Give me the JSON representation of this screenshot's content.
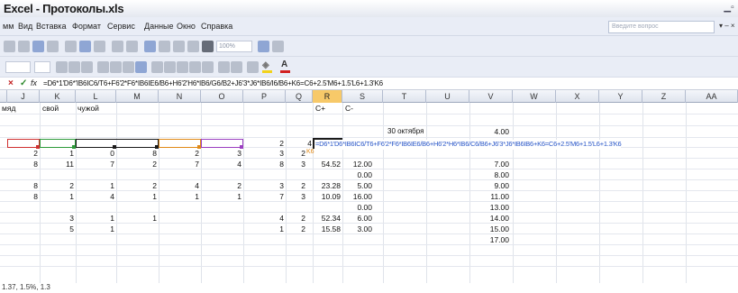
{
  "window": {
    "title": "Excel - Протоколы.xls",
    "controls_icon": "minimize-icon"
  },
  "menu": {
    "items": [
      "мм",
      "Вид",
      "Вставка",
      "Формат",
      "Сервис",
      "Данные",
      "Окно",
      "Справка"
    ],
    "help_placeholder": "Введите вопрос",
    "window_controls": "▾ – ×"
  },
  "toolbar": {
    "zoom": "100%"
  },
  "formula_bar": {
    "cancel_icon": "×",
    "enter_icon": "✓",
    "fx_label": "fx",
    "content": "=D6*1'D6*'IB6IC6/T6+F6'2*F6*IB6IE6/B6+H6'2'H6*IB6/G6/B2+J6'3*J6*IB6/I6/B6+K6=C6+2.5'M6+1.5'L6+1.3'K6"
  },
  "columns": [
    "J",
    "K",
    "L",
    "M",
    "N",
    "O",
    "P",
    "Q",
    "R",
    "S",
    "T",
    "U",
    "V",
    "W",
    "X",
    "Y",
    "Z",
    "AA"
  ],
  "active_column": "R",
  "rows": {
    "header_row": [
      "мяд",
      "свой",
      "чужой"
    ],
    "header_r": "C+",
    "header_s": "C-",
    "date_label": "30 октября",
    "date_value": "4.00",
    "formula_row_p": "2",
    "formula_row_q": "4",
    "formula_text": "=D6*1'D6*IB6IC6/T6+F6'2*F6*IB6IE6/B6+H6'2*H6*IB6/C6/B6+J6'3*J6*IB6IB6+K6=C6+2.5'M6+1.5'L6+1.3'K6",
    "row2": [
      "2",
      "1",
      "0",
      "8",
      "2",
      "3",
      "3",
      "2"
    ],
    "row2_q_note": "K6",
    "data": [
      {
        "j": "8",
        "k": "11",
        "l": "7",
        "m": "2",
        "n": "7",
        "o": "4",
        "p": "8",
        "q": "3",
        "r": "54.52",
        "s": "12.00",
        "v": "7.00"
      },
      {
        "s": "0.00",
        "v": "8.00"
      },
      {
        "j": "8",
        "k": "2",
        "l": "1",
        "m": "2",
        "n": "4",
        "o": "2",
        "p": "3",
        "q": "2",
        "r": "23.28",
        "s": "5.00",
        "v": "9.00"
      },
      {
        "j": "8",
        "k": "1",
        "l": "4",
        "m": "1",
        "n": "1",
        "o": "1",
        "p": "7",
        "q": "3",
        "r": "10.09",
        "s": "16.00",
        "v": "11.00"
      },
      {
        "s": "0.00",
        "v": "13.00"
      },
      {
        "k": "3",
        "l": "1",
        "m": "1",
        "p": "4",
        "q": "2",
        "r": "52.34",
        "s": "6.00",
        "v": "14.00"
      },
      {
        "k": "5",
        "l": "1",
        "p": "1",
        "q": "2",
        "r": "15.58",
        "s": "3.00",
        "v": "15.00"
      },
      {
        "v": "17.00"
      }
    ]
  },
  "status_fragment": "1.37, 1.5%, 1.3",
  "colors": {
    "ref_red": "#d03030",
    "ref_green": "#2e9a3a",
    "ref_purple": "#9b3fc0",
    "ref_blue": "#2b58c8",
    "ref_orange": "#e08a18",
    "active_header": "#f7c969"
  }
}
